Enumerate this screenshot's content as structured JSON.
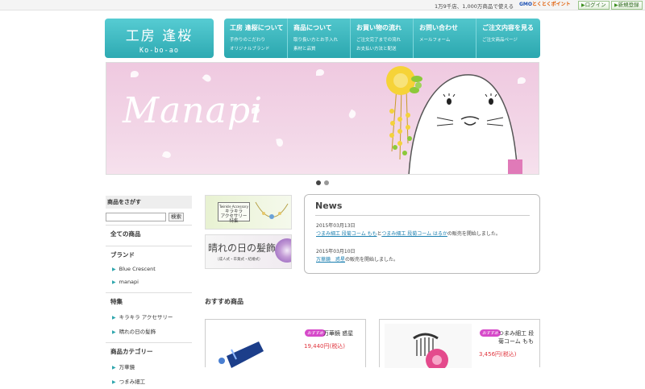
{
  "topbar": {
    "tagline": "1万9千店、1,000万商品で使える",
    "gmo_brand": "GMO",
    "gmo_service": "とくとくポイント",
    "login_label": "ログイン",
    "register_label": "新規登録"
  },
  "logo": {
    "jp": "工房 逢桜",
    "en": "Ko-bo-ao"
  },
  "nav": [
    {
      "title": "工房 逢桜について",
      "subs": [
        "手作りのこだわり",
        "オリジナルブランド"
      ]
    },
    {
      "title": "商品について",
      "subs": [
        "取り扱い方とお手入れ",
        "素材と品質"
      ]
    },
    {
      "title": "お買い物の流れ",
      "subs": [
        "ご注文完了までの流れ",
        "お支払い方法と配送"
      ]
    },
    {
      "title": "お問い合わせ",
      "subs": [
        "メールフォーム"
      ]
    },
    {
      "title": "ご注文内容を見る",
      "subs": [
        "ご注文商品ページ"
      ]
    }
  ],
  "hero": {
    "title": "Manapi",
    "slides": 2,
    "active_slide": 1
  },
  "sidebar": {
    "search_title": "商品をさがす",
    "search_button": "検索",
    "all_items": "全ての商品",
    "brand_title": "ブランド",
    "brands": [
      "Blue Crescent",
      "manapi"
    ],
    "feature_title": "特集",
    "features": [
      "キラキラ アクセサリー",
      "晴れの日の髪飾"
    ],
    "category_title": "商品カテゴリー",
    "categories": [
      "万華鏡",
      "つまみ細工"
    ]
  },
  "banners": {
    "b1_en": "Twinkle Accessory",
    "b1_jp": "キラキラ",
    "b1_jp2": "アクセサリー特集",
    "b2_title": "晴れの日の髪飾り",
    "b2_sub": "（成人式・卒業式・結婚式）"
  },
  "news": {
    "title": "News",
    "items": [
      {
        "date": "2015年03月13日",
        "link1": "つまみ細工 段菊コーム もも",
        "joiner": "と",
        "link2": "つまみ細工 段菊コーム はるか",
        "suffix": "の販売を開始しました。"
      },
      {
        "date": "2015年03月10日",
        "link1": "万華鏡　惑星",
        "suffix": "の販売を開始しました。"
      }
    ]
  },
  "recommend_title": "おすすめ商品",
  "products": [
    {
      "badge": "おすすめ",
      "name": "万華鏡 惑星",
      "price": "19,440円(税込)"
    },
    {
      "badge": "おすすめ",
      "name": "つまみ細工 段菊コーム もも",
      "price": "3,456円(税込)"
    }
  ],
  "colors": {
    "accent": "#33b0b8",
    "price": "#e0353e",
    "badge": "#d649c9"
  }
}
